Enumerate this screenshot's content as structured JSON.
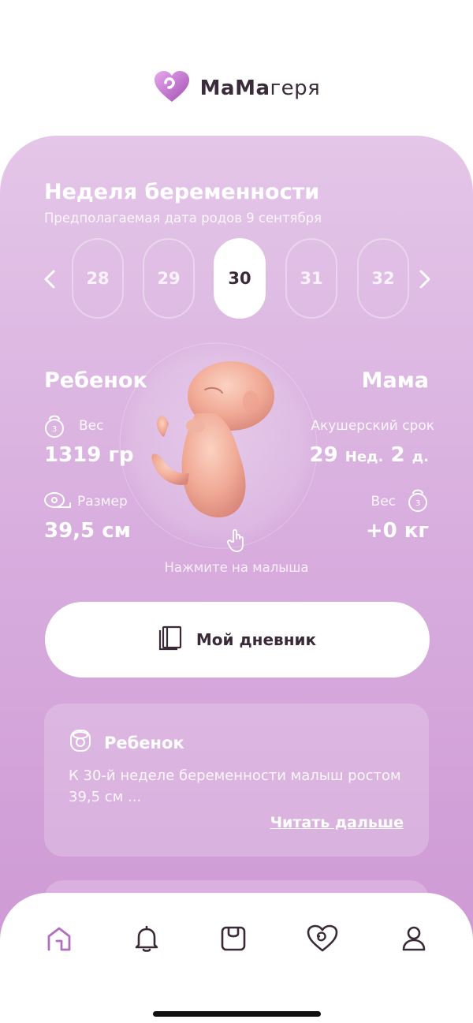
{
  "app": {
    "brand_bold": "МаМа",
    "brand_regular": "геря",
    "brand_color": "#c77dcf"
  },
  "pregnancy": {
    "title": "Неделя беременности",
    "due_label": "Предполагаемая дата родов",
    "due_date": "9 сентября",
    "weeks": [
      "28",
      "29",
      "30",
      "31",
      "32"
    ],
    "selected_week": "30"
  },
  "baby": {
    "title": "Ребенок",
    "weight_label": "Вес",
    "weight_value": "1319 гр",
    "size_label": "Размер",
    "size_value": "39,5 см",
    "hint": "Нажмите на малыша"
  },
  "mom": {
    "title": "Мама",
    "term_label": "Акушерский срок",
    "term_weeks": "29",
    "term_weeks_unit": "Нед.",
    "term_days": "2",
    "term_days_unit": "д.",
    "weight_label": "Вес",
    "weight_value": "+0 кг"
  },
  "diary": {
    "label": "Мой дневник"
  },
  "article": {
    "title": "Ребенок",
    "text": "К 30-й неделе беременности малыш ростом 39,5 см ...",
    "read_more": "Читать дальше"
  },
  "tabbar": {
    "items": [
      "home-icon",
      "bell-icon",
      "scale-icon",
      "heart-icon",
      "profile-icon"
    ],
    "active_color": "#b46dc1",
    "inactive_color": "#3a2a38"
  }
}
